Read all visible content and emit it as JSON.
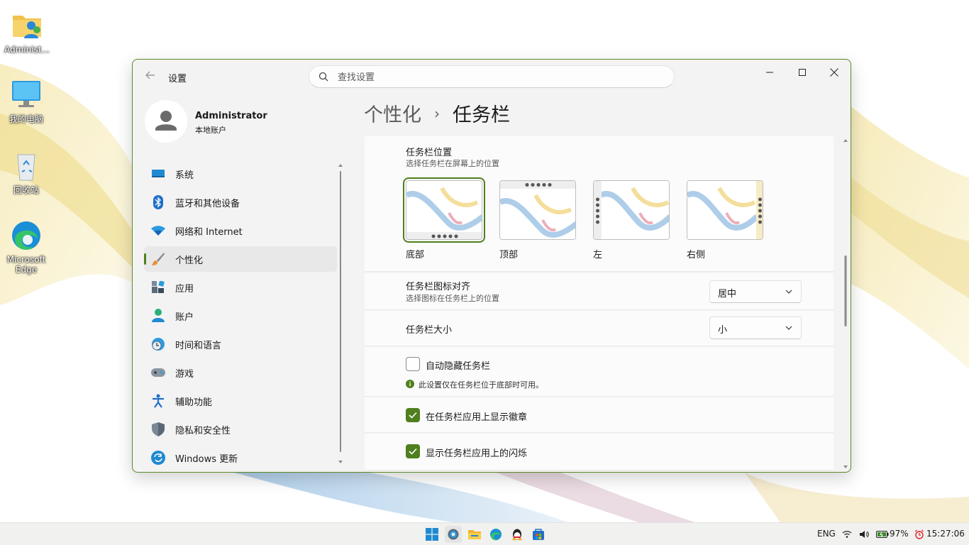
{
  "desktop": {
    "icons": [
      {
        "label": "Administ..."
      },
      {
        "label": "我的电脑"
      },
      {
        "label": "回收站"
      },
      {
        "label": "Microsoft Edge"
      }
    ]
  },
  "window": {
    "app_title": "设置",
    "search_placeholder": "查找设置",
    "profile": {
      "name": "Administrator",
      "account_type": "本地账户"
    },
    "nav": [
      {
        "label": "系统",
        "icon": "monitor-icon"
      },
      {
        "label": "蓝牙和其他设备",
        "icon": "bluetooth-icon"
      },
      {
        "label": "网络和 Internet",
        "icon": "wifi-icon"
      },
      {
        "label": "个性化",
        "icon": "brush-icon",
        "active": true
      },
      {
        "label": "应用",
        "icon": "apps-icon"
      },
      {
        "label": "账户",
        "icon": "person-icon"
      },
      {
        "label": "时间和语言",
        "icon": "clock-globe-icon"
      },
      {
        "label": "游戏",
        "icon": "gamepad-icon"
      },
      {
        "label": "辅助功能",
        "icon": "accessibility-icon"
      },
      {
        "label": "隐私和安全性",
        "icon": "shield-icon"
      },
      {
        "label": "Windows 更新",
        "icon": "update-icon"
      }
    ],
    "breadcrumb": {
      "parent": "个性化",
      "separator": "›",
      "current": "任务栏"
    },
    "taskbar_position": {
      "title": "任务栏位置",
      "subtitle": "选择任务栏在屏幕上的位置",
      "options": [
        {
          "label": "底部",
          "selected": true
        },
        {
          "label": "顶部",
          "selected": false
        },
        {
          "label": "左",
          "selected": false
        },
        {
          "label": "右侧",
          "selected": false
        }
      ]
    },
    "alignment": {
      "title": "任务栏图标对齐",
      "subtitle": "选择图标在任务栏上的位置",
      "value": "居中"
    },
    "size": {
      "title": "任务栏大小",
      "value": "小"
    },
    "auto_hide": {
      "label": "自动隐藏任务栏",
      "checked": false,
      "note": "此设置仅在任务栏位于底部时可用。"
    },
    "badges": {
      "label": "在任务栏应用上显示徽章",
      "checked": true
    },
    "flashing": {
      "label": "显示任务栏应用上的闪烁",
      "checked": true
    }
  },
  "taskbar": {
    "apps": [
      "start-icon",
      "settings-icon",
      "file-explorer-icon",
      "edge-icon",
      "qq-icon",
      "store-icon"
    ],
    "language": "ENG",
    "battery": "97%",
    "clock": "15:27:06"
  },
  "colors": {
    "accent": "#4f7f1f"
  }
}
